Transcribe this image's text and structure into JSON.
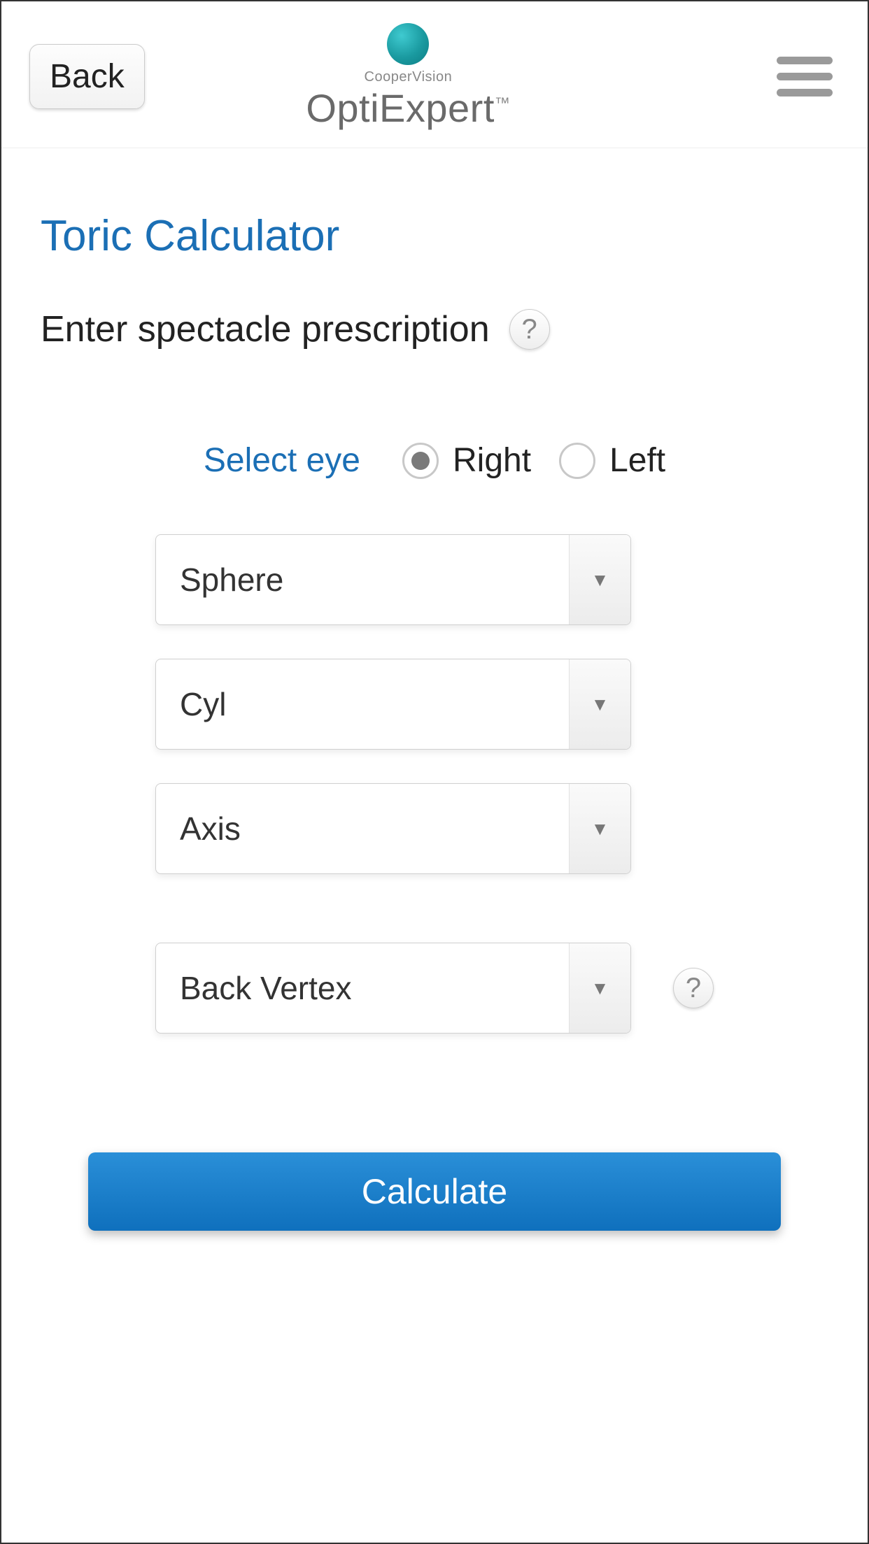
{
  "header": {
    "back_label": "Back",
    "brand_sub": "CooperVision",
    "brand_main": "OptiExpert",
    "brand_tm": "™"
  },
  "page": {
    "title": "Toric Calculator",
    "subtitle": "Enter spectacle prescription",
    "help_glyph": "?"
  },
  "eye": {
    "label": "Select eye",
    "options": {
      "right": "Right",
      "left": "Left"
    },
    "selected": "right"
  },
  "fields": {
    "sphere": "Sphere",
    "cyl": "Cyl",
    "axis": "Axis",
    "back_vertex": "Back Vertex"
  },
  "actions": {
    "calculate": "Calculate"
  },
  "icons": {
    "dropdown_arrow": "▼"
  }
}
